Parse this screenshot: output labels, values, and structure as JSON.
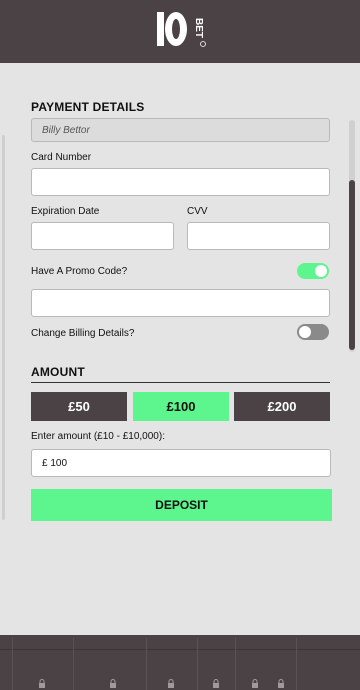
{
  "brand": {
    "logo_number": "10",
    "logo_word": "BET",
    "accent": "#5cf58e",
    "dark": "#4a4245"
  },
  "payment": {
    "title": "PAYMENT DETAILS",
    "cardholder_value": "Billy Bettor",
    "card_number_label": "Card Number",
    "card_number_value": "",
    "expiration_label": "Expiration Date",
    "expiration_value": "",
    "cvv_label": "CVV",
    "cvv_value": "",
    "promo_label": "Have A Promo Code?",
    "promo_toggle": true,
    "promo_value": "",
    "billing_label": "Change Billing Details?",
    "billing_toggle": false
  },
  "amount": {
    "title": "AMOUNT",
    "presets": [
      "£50",
      "£100",
      "£200"
    ],
    "selected": "£100",
    "enter_label": "Enter amount (£10 - £10,000):",
    "value": "£ 100"
  },
  "deposit_label": "DEPOSIT",
  "footer_icons": [
    "lock-icon",
    "lock-icon",
    "lock-icon",
    "lock-icon",
    "lock-icon",
    "lock-icon"
  ]
}
